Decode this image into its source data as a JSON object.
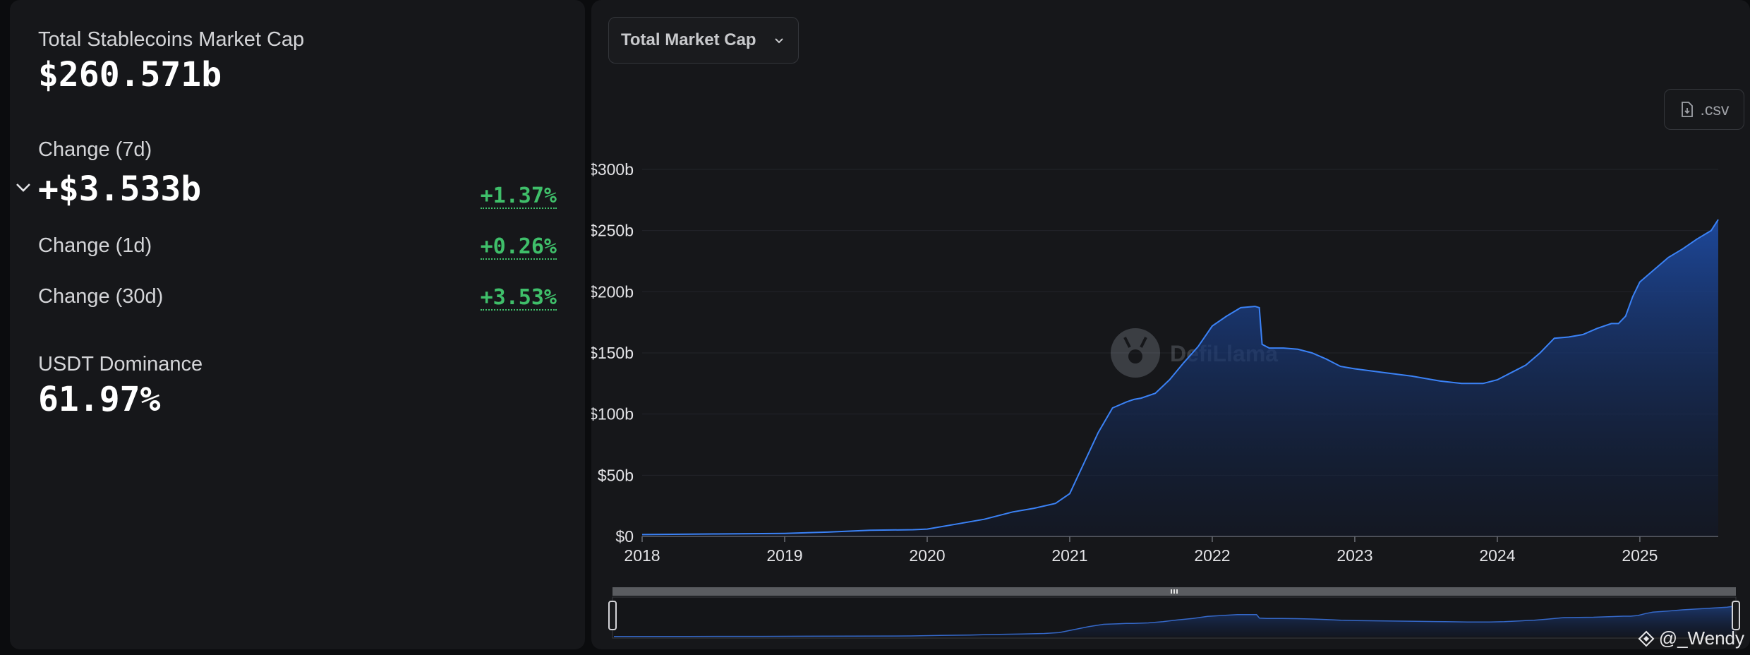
{
  "stats": {
    "total_label": "Total Stablecoins Market Cap",
    "total_value": "$260.571b",
    "change7d_label": "Change (7d)",
    "change7d_value": "+$3.533b",
    "change7d_pct": "+1.37%",
    "change1d_label": "Change (1d)",
    "change1d_pct": "+0.26%",
    "change30d_label": "Change (30d)",
    "change30d_pct": "+3.53%",
    "dominance_label": "USDT Dominance",
    "dominance_value": "61.97%"
  },
  "toolbar": {
    "dropdown_label": "Total Market Cap",
    "csv_label": ".csv"
  },
  "watermark": {
    "brand": "DefiLlama",
    "user": "@_Wendy"
  },
  "colors": {
    "positive": "#3fbf6a",
    "line": "#3b82f6",
    "area_top": "#1e4aa0"
  },
  "chart_data": {
    "type": "area",
    "title": "",
    "xlabel": "",
    "ylabel": "",
    "yticks": [
      "$0",
      "$50b",
      "$100b",
      "$150b",
      "$200b",
      "$250b",
      "$300b"
    ],
    "ylim": [
      0,
      300
    ],
    "xticks": [
      "2018",
      "2019",
      "2020",
      "2021",
      "2022",
      "2023",
      "2024",
      "2025"
    ],
    "xlim": [
      2018.0,
      2025.55
    ],
    "grid": true,
    "series": [
      {
        "x": [
          2018.0,
          2018.5,
          2019.0,
          2019.3,
          2019.6,
          2019.9,
          2020.0,
          2020.2,
          2020.4,
          2020.6,
          2020.75,
          2020.9,
          2021.0,
          2021.1,
          2021.2,
          2021.3,
          2021.4,
          2021.45,
          2021.5,
          2021.6,
          2021.7,
          2021.8,
          2021.9,
          2022.0,
          2022.1,
          2022.2,
          2022.3,
          2022.33,
          2022.35,
          2022.4,
          2022.5,
          2022.6,
          2022.7,
          2022.8,
          2022.9,
          2023.0,
          2023.2,
          2023.4,
          2023.6,
          2023.75,
          2023.9,
          2024.0,
          2024.1,
          2024.2,
          2024.3,
          2024.4,
          2024.5,
          2024.6,
          2024.7,
          2024.8,
          2024.85,
          2024.9,
          2024.95,
          2025.0,
          2025.1,
          2025.2,
          2025.3,
          2025.4,
          2025.5,
          2025.55
        ],
        "y": [
          1.5,
          2,
          2.5,
          3.5,
          5,
          5.5,
          6,
          10,
          14,
          20,
          23,
          27,
          35,
          60,
          85,
          105,
          110,
          112,
          113,
          117,
          128,
          142,
          155,
          172,
          180,
          187,
          188,
          187,
          157,
          154,
          154,
          153,
          150,
          145,
          139,
          137,
          134,
          131,
          127,
          125,
          125,
          128,
          134,
          140,
          150,
          162,
          163,
          165,
          170,
          174,
          174,
          180,
          196,
          208,
          218,
          228,
          235,
          243,
          250,
          259
        ]
      }
    ]
  }
}
